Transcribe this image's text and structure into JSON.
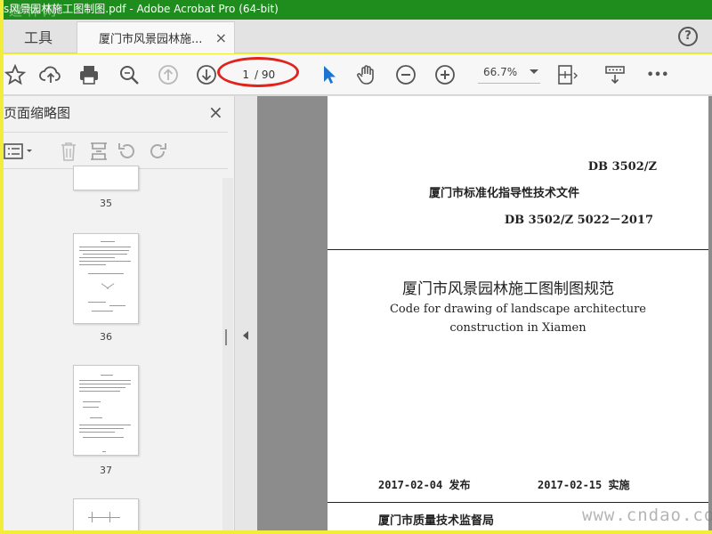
{
  "window": {
    "title": "s风景园林施工图制图.pdf - Adobe Acrobat Pro (64-bit)",
    "watermark_top": "道林网"
  },
  "tabs": {
    "tools_label": "工具",
    "doc_label": "厦门市风景园林施...",
    "close_glyph": "×",
    "help_glyph": "?"
  },
  "toolbar": {
    "current_page": "1",
    "total_pages": "/ 90",
    "zoom": "66.7%",
    "more_glyph": "•••"
  },
  "sidebar": {
    "title": "页面缩略图",
    "close_glyph": "×",
    "thumbnails": [
      {
        "num": "35"
      },
      {
        "num": "36"
      },
      {
        "num": "37"
      }
    ]
  },
  "document": {
    "db_code": "DB 3502/Z",
    "standard_type": "厦门市标准化指导性技术文件",
    "db_number": "DB 3502/Z   5022－2017",
    "title_cn": "厦门市风景园林施工图制图规范",
    "title_en_line1": "Code for drawing of landscape architecture",
    "title_en_line2": "construction in Xiamen",
    "publish": "2017-02-04 发布",
    "implement": "2017-02-15 实施",
    "issuer": "厦门市质量技术监督局"
  },
  "watermark_bottom": "www.cndao.com",
  "colors": {
    "border": "#f2ed3a",
    "titlebar": "#1e8d1e",
    "highlight_circle": "#e0241d",
    "select_cursor": "#1b75d0"
  }
}
